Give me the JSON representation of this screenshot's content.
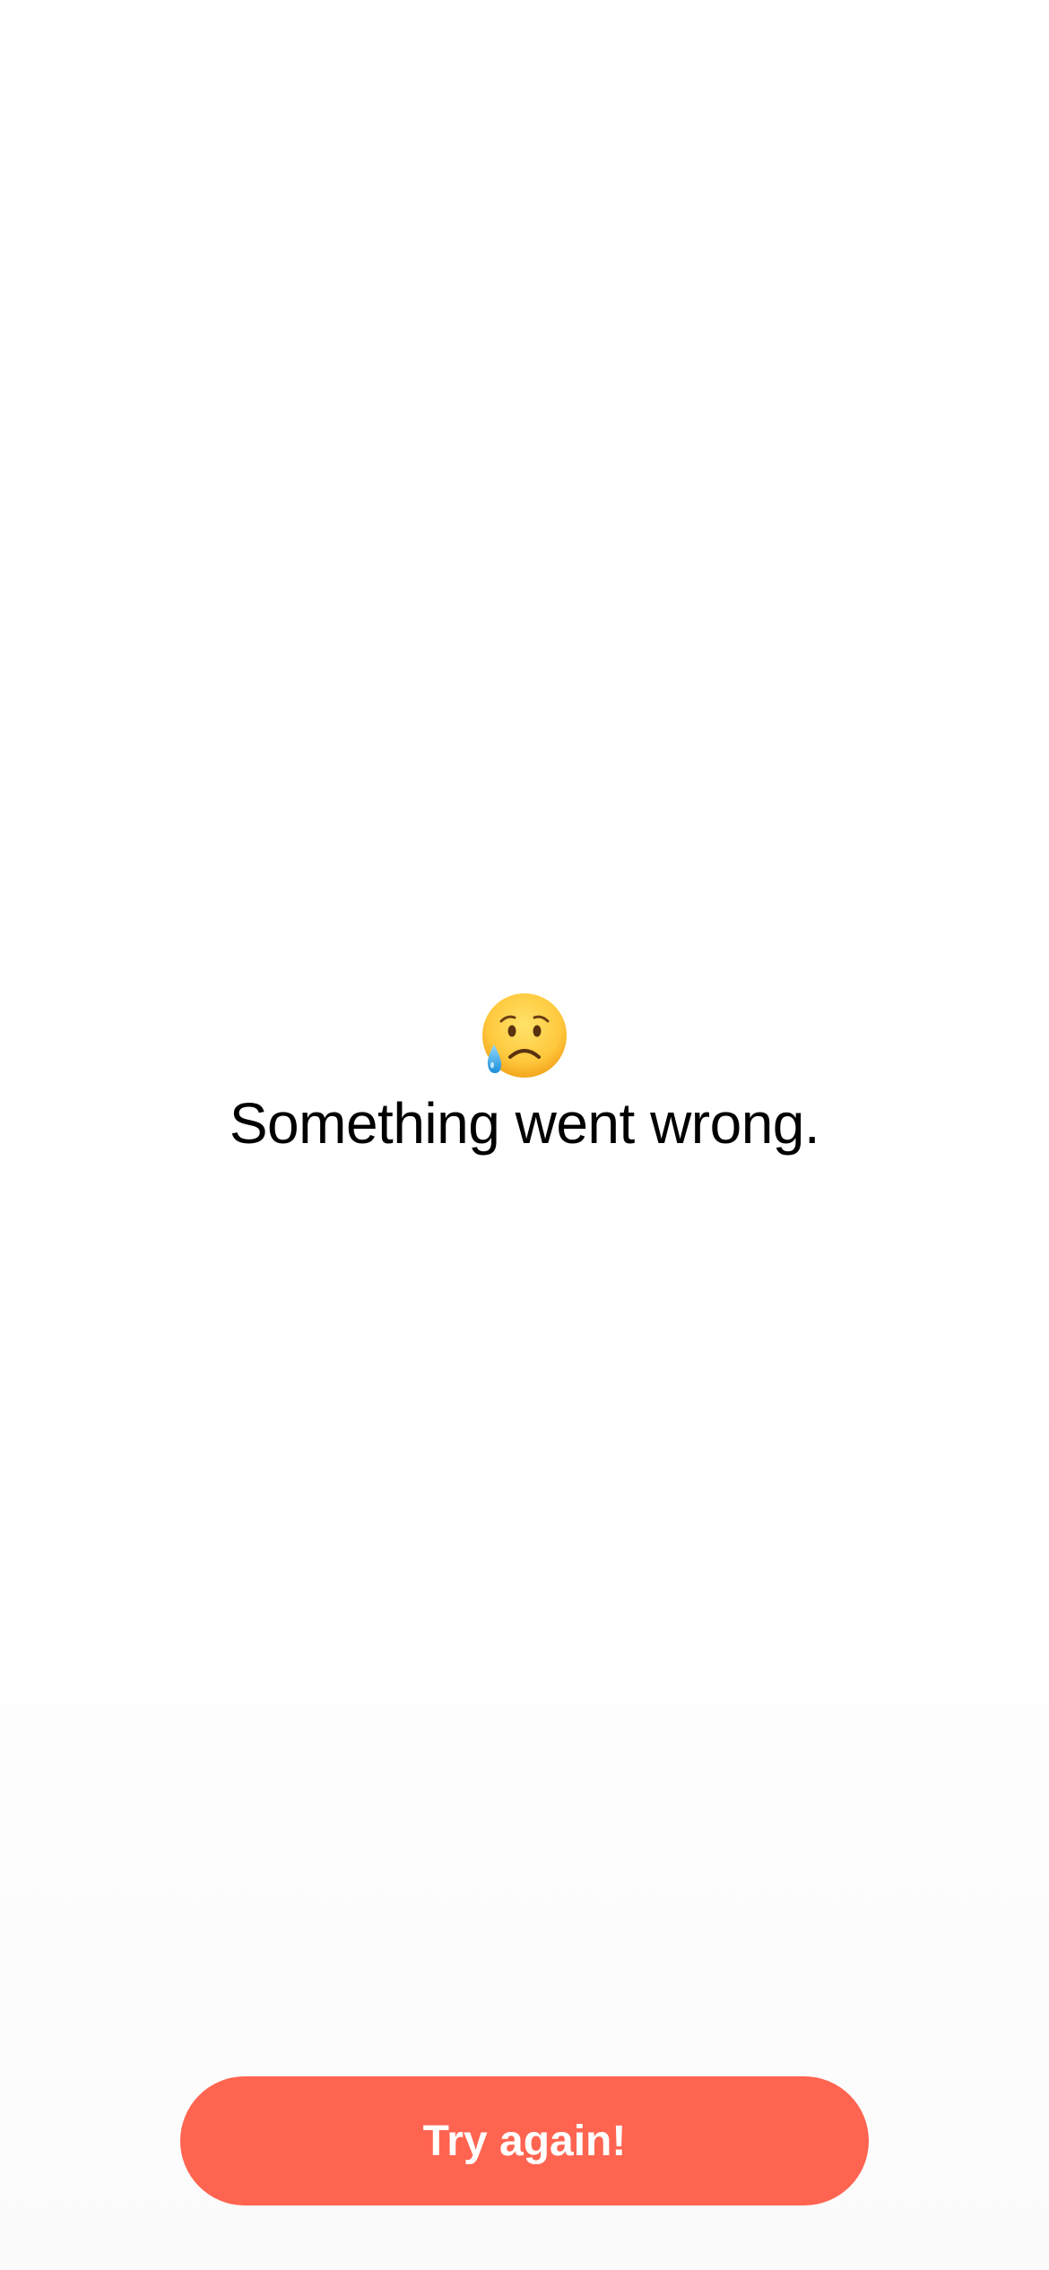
{
  "error": {
    "emoji": "sad-but-relieved-face-icon",
    "message": "Something went wrong."
  },
  "actions": {
    "retry_label": "Try again!"
  },
  "colors": {
    "accent": "#FF6450",
    "text": "#000000",
    "background": "#FFFFFF",
    "emoji_face": "#FFC83D",
    "emoji_tear": "#36A8E8"
  }
}
